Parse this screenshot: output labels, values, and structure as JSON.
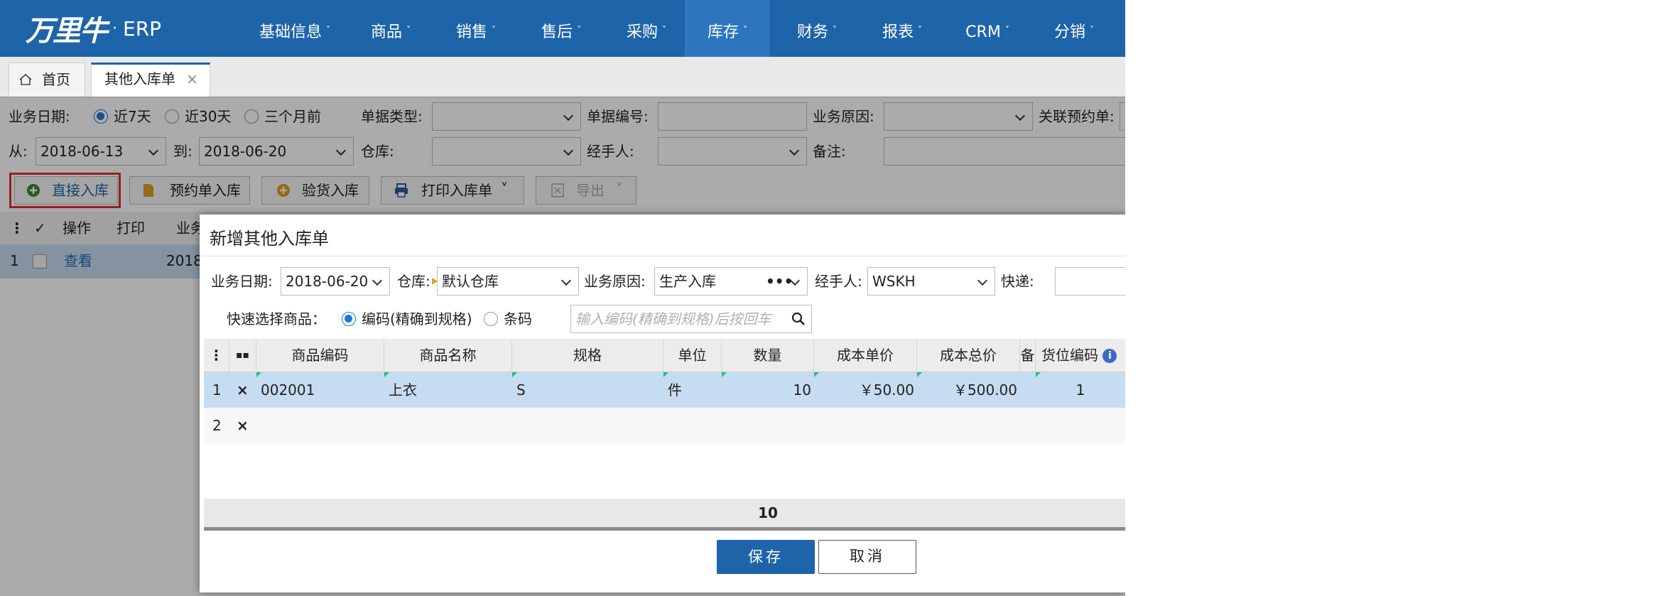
{
  "brand": {
    "logo_text": "万里牛",
    "separator": "·",
    "product": "ERP"
  },
  "nav": [
    {
      "label": "基础信息"
    },
    {
      "label": "商品"
    },
    {
      "label": "销售"
    },
    {
      "label": "售后"
    },
    {
      "label": "采购"
    },
    {
      "label": "库存"
    },
    {
      "label": "财务"
    },
    {
      "label": "报表"
    },
    {
      "label": "CRM"
    },
    {
      "label": "分销"
    }
  ],
  "nav_caret": "˅",
  "tabs": {
    "home": "首页",
    "current": "其他入库单",
    "close": "×"
  },
  "filters": {
    "date_label": "业务日期:",
    "range_7": "近7天",
    "range_30": "近30天",
    "range_3m": "三个月前",
    "doc_type_label": "单据类型:",
    "doc_no_label": "单据编号:",
    "reason_label": "业务原因:",
    "reservation_label": "关联预约单:",
    "from_label": "从:",
    "from_value": "2018-06-13",
    "to_label": "到:",
    "to_value": "2018-06-20",
    "warehouse_label": "仓库:",
    "handler_label": "经手人:",
    "remark_label": "备注:"
  },
  "toolbar": {
    "direct": "直接入库",
    "reserve": "预约单入库",
    "inspect": "验货入库",
    "print": "打印入库单",
    "export": "导出"
  },
  "list": {
    "headers": {
      "check": "✓",
      "op": "操作",
      "print": "打印",
      "biz": "业务"
    },
    "row": {
      "index": "1",
      "view": "查看",
      "date": "2018"
    }
  },
  "modal": {
    "title": "新增其他入库单",
    "date_label": "业务日期:",
    "date_value": "2018-06-20",
    "warehouse_label": "仓库:",
    "warehouse_value": "默认仓库",
    "reason_label": "业务原因:",
    "reason_value": "生产入库",
    "reason_more": "•••",
    "handler_label": "经手人:",
    "handler_value": "WSKH",
    "express_label": "快递:",
    "quick_label": "快速选择商品：",
    "opt_code": "编码(精确到规格)",
    "opt_barcode": "条码",
    "search_placeholder": "输入编码(精确到规格)后按回车",
    "columns": {
      "code": "商品编码",
      "name": "商品名称",
      "spec": "规格",
      "unit": "单位",
      "qty": "数量",
      "unit_cost": "成本单价",
      "total_cost": "成本总价",
      "remark": "备",
      "location": "货位编码",
      "info": "i"
    },
    "rows": [
      {
        "index": "1",
        "del": "×",
        "code": "002001",
        "name": "上衣",
        "spec": "S",
        "unit": "件",
        "qty": "10",
        "unit_cost": "￥50.00",
        "total_cost": "￥500.00",
        "location": "1"
      },
      {
        "index": "2",
        "del": "×"
      }
    ],
    "total_qty": "10",
    "save": "保存",
    "cancel": "取消"
  },
  "colors": {
    "nav_bg": "#1e64a8",
    "accent": "#1e78d4",
    "row_selected": "#c6dcf0"
  }
}
